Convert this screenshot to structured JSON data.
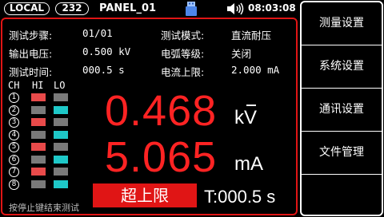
{
  "status": {
    "mode": "LOCAL",
    "addr": "232",
    "panel": "PANEL_01",
    "time": "08:03:08",
    "icons": [
      "usb-icon",
      "speaker-volume-icon"
    ]
  },
  "params": {
    "step_label": "测试步骤:",
    "step_value": "01/01",
    "mode_label": "测试模式:",
    "mode_value": "直流耐压",
    "voltage_label": "输出电压:",
    "voltage_value": "0.500 kV",
    "arc_label": "电弧等级:",
    "arc_value": "关闭",
    "time_label": "测试时间:",
    "time_value": "000.5 s",
    "limit_label": "电流上限:",
    "limit_value": "2.000 mA"
  },
  "channels": {
    "headers": [
      "CH",
      "HI",
      "LO"
    ],
    "rows": [
      {
        "num": "1",
        "hi": "red",
        "lo": "off"
      },
      {
        "num": "2",
        "hi": "off",
        "lo": "cyan"
      },
      {
        "num": "3",
        "hi": "red",
        "lo": "off"
      },
      {
        "num": "4",
        "hi": "off",
        "lo": "cyan"
      },
      {
        "num": "5",
        "hi": "red",
        "lo": "off"
      },
      {
        "num": "6",
        "hi": "off",
        "lo": "cyan"
      },
      {
        "num": "7",
        "hi": "red",
        "lo": "off"
      },
      {
        "num": "8",
        "hi": "off",
        "lo": "cyan"
      }
    ]
  },
  "readings": {
    "voltage": "0.468",
    "voltage_unit": "kV",
    "current": "5.065",
    "current_unit": "mA"
  },
  "result": {
    "alarm": "超上限",
    "timer": "T:000.5 s",
    "hint": "按停止键结束测试"
  },
  "menu": [
    "测量设置",
    "系统设置",
    "通讯设置",
    "文件管理"
  ],
  "colors": {
    "accent_red": "#e01515",
    "reading_red": "#ff2323",
    "hi_on": "#e84a4a",
    "lo_on": "#1ec8c8",
    "off": "#7a7a7a"
  }
}
